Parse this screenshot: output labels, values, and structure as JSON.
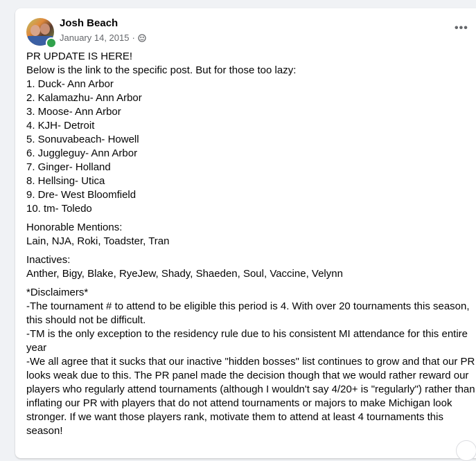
{
  "post": {
    "author": "Josh Beach",
    "date": "January 14, 2015",
    "dot": "·",
    "privacy_icon": "globe-icon",
    "more_label": "•••",
    "lines": [
      "PR UPDATE IS HERE!",
      "Below is the link to the specific post. But for those too lazy:",
      "1. Duck- Ann Arbor",
      "2. Kalamazhu- Ann Arbor",
      "3. Moose- Ann Arbor",
      "4. KJH- Detroit",
      "5. Sonuvabeach- Howell",
      "6. Juggleguy- Ann Arbor",
      "7. Ginger- Holland",
      "8. Hellsing- Utica",
      "9. Dre- West Bloomfield",
      "10. tm- Toledo"
    ],
    "honorable_title": "Honorable Mentions:",
    "honorable_list": "Lain, NJA, Roki, Toadster, Tran",
    "inactives_title": "Inactives:",
    "inactives_list": "Anther, Bigy, Blake, RyeJew, Shady, Shaeden, Soul, Vaccine, Velynn",
    "disclaimers_title": "*Disclaimers*",
    "disclaimer_1": "-The tournament # to attend to be eligible this period is 4. With over 20 tournaments this season, this should not be difficult.",
    "disclaimer_2": "-TM is the only exception to the residency rule due to his consistent MI attendance for this entire year",
    "disclaimer_3": "-We all agree that it sucks that our inactive \"hidden bosses\" list continues to grow and that our PR looks weak due to this. The PR panel made the decision though that we would rather reward our players who regularly attend tournaments (although I wouldn't say 4/20+ is \"regularly\") rather than inflating our PR with players that do not attend tournaments or majors to make Michigan look stronger. If we want those players rank, motivate them to attend at least 4 tournaments this season!"
  },
  "colors": {
    "background": "#f0f2f5",
    "card": "#ffffff",
    "online": "#31a24c",
    "meta_text": "#65676b"
  }
}
